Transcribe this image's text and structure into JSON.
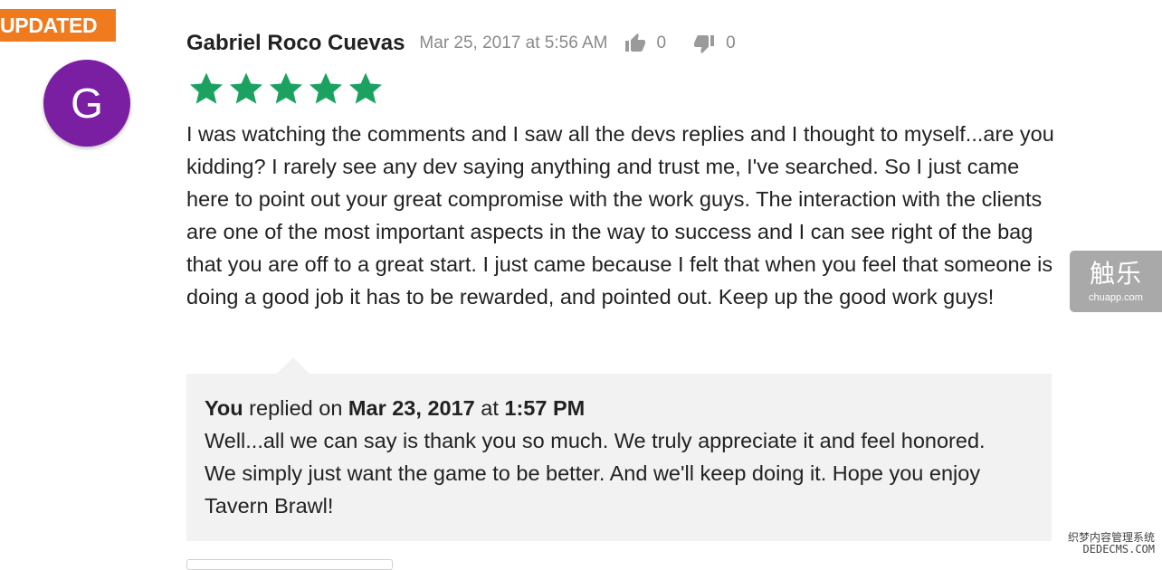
{
  "badge": {
    "label": "UPDATED"
  },
  "review": {
    "avatar_letter": "G",
    "author": "Gabriel Roco Cuevas",
    "date": "Mar 25, 2017 at 5:56 AM",
    "thumbs_up_count": "0",
    "thumbs_down_count": "0",
    "rating": 5,
    "rating_max": 5,
    "star_color": "#1ba261",
    "text": "I was watching the comments and I saw all the devs replies and I thought to myself...are you kidding? I rarely see any dev saying anything and trust me, I've searched. So I just came here to point out your great compromise with the work guys. The interaction with the clients are one of the most important aspects in the way to success and I can see right of the bag that you are off to a great start. I just came because I felt that when you feel that someone is doing a good job it has to be rewarded, and pointed out. Keep up the good work guys!"
  },
  "reply": {
    "who": "You",
    "replied_on": "replied on",
    "date": "Mar 23, 2017",
    "at": "at",
    "time": "1:57 PM",
    "text": "Well...all we can say is thank you so much. We truly appreciate it and feel honored. We simply just want the game to be better. And we'll keep doing it. Hope you enjoy Tavern Brawl!"
  },
  "side_widget": {
    "title": "触乐",
    "url": "chuapp.com"
  },
  "watermark": {
    "line1": "织梦内容管理系统",
    "line2": "DEDECMS.COM"
  },
  "colors": {
    "badge": "#f07a1e",
    "avatar": "#7b1fa2",
    "reply_bg": "#f2f2f2"
  }
}
